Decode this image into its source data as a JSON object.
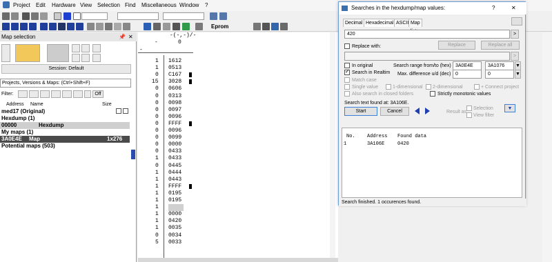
{
  "menu": [
    "Project",
    "Edit",
    "Hardware",
    "View",
    "Selection",
    "Find",
    "Miscellaneous",
    "Window",
    "?"
  ],
  "toolbar": {
    "epromLabel": "Eprom",
    "dropdown1": "",
    "dropdown2": ""
  },
  "leftPanel": {
    "title": "Map selection",
    "session": "Session: Default",
    "combo": "Projects, Versions & Maps: (Ctrl+Shift+F)",
    "filterLabel": "Filter:",
    "offLabel": "Off",
    "columns": {
      "address": "Address",
      "name": "Name",
      "size": "Size"
    },
    "tree": [
      {
        "label": "med17 (Original)"
      },
      {
        "label": "Hexdump (1)"
      },
      {
        "address": "00000",
        "name": "Hexdump"
      },
      {
        "label": "My maps (1)"
      },
      {
        "address": "3A0E4E",
        "name": "Map",
        "size": "1x276"
      },
      {
        "label": "Potential maps (503)"
      }
    ]
  },
  "hexView": {
    "header": "-(-,-)/-",
    "headerZero": "0",
    "dash1": "-",
    "dash2": "-",
    "leftCol": [
      "1",
      "1",
      "0",
      "15",
      "0",
      "0",
      "0",
      "0",
      "0",
      "0",
      "0",
      "0",
      "0",
      "0",
      "1",
      "0",
      "1",
      "1",
      "1",
      "1",
      "1",
      "1",
      "1",
      "1",
      "1",
      "0",
      "5",
      "1",
      "1",
      "1"
    ],
    "rightCol": [
      "1612",
      "0513",
      "C167",
      "3028",
      "0606",
      "0313",
      "0098",
      "0097",
      "0096",
      "FFFF",
      "0096",
      "0099",
      "0000",
      "0433",
      "0433",
      "0445",
      "0444",
      "0443",
      "FFFF",
      "0195",
      "0195",
      "0195",
      "0000",
      "0420",
      "0035",
      "0034",
      "0033"
    ],
    "leftCol2": [
      "1",
      "1",
      "0",
      "15",
      "0",
      "0",
      "0",
      "0",
      "0",
      "0",
      "0",
      "0",
      "0",
      "0",
      "1",
      "0",
      "1",
      "1",
      "1",
      "1",
      "1",
      "1",
      "1",
      "1",
      "1",
      "0",
      "5",
      "1",
      "1",
      "1"
    ]
  },
  "dialog": {
    "title": "Searches in the hexdump/map values:",
    "help": "?",
    "close": "✕",
    "tabs": [
      "Decimal",
      "Hexadecimal",
      "ASCII",
      "Map list"
    ],
    "searchValue": "420",
    "replaceWith": "Replace with:",
    "replaceBtn": "Replace",
    "replaceAllBtn": "Replace all",
    "inOriginal": "In original",
    "searchRealtime": "Search in Realtim",
    "matchCase": "Match case",
    "singleValue": "Single value",
    "oneDim": "1-dimensional",
    "twoDim": "2-dimensional",
    "connectProject": "+ Connect project",
    "alsoClosed": "Also search in closed folders",
    "strictlyMono": "Strictly monotonic values",
    "rangeLabel": "Search range from/to (hex)",
    "rangeFrom": "3A0E4E",
    "rangeTo": "3A1076",
    "maxDiffLabel": "Max. difference u/d (dec)",
    "maxDiffU": "0",
    "maxDiffD": "0",
    "searchFound": "Search text found at: 3A106E.",
    "startBtn": "Start",
    "cancelBtn": "Cancel",
    "resultAs": "Result as",
    "selection": "Selection",
    "viewFilter": "View filter",
    "resultHeader": {
      "no": "No.",
      "address": "Address",
      "found": "Found data"
    },
    "results": [
      {
        "no": "1",
        "address": "3A106E",
        "found": "0420"
      }
    ],
    "status": "Search finished. 1 occurences found."
  },
  "colors": {
    "accent": "#0a64c8",
    "selection": "#4a4a4a",
    "highlight": "#d0d0d0"
  }
}
